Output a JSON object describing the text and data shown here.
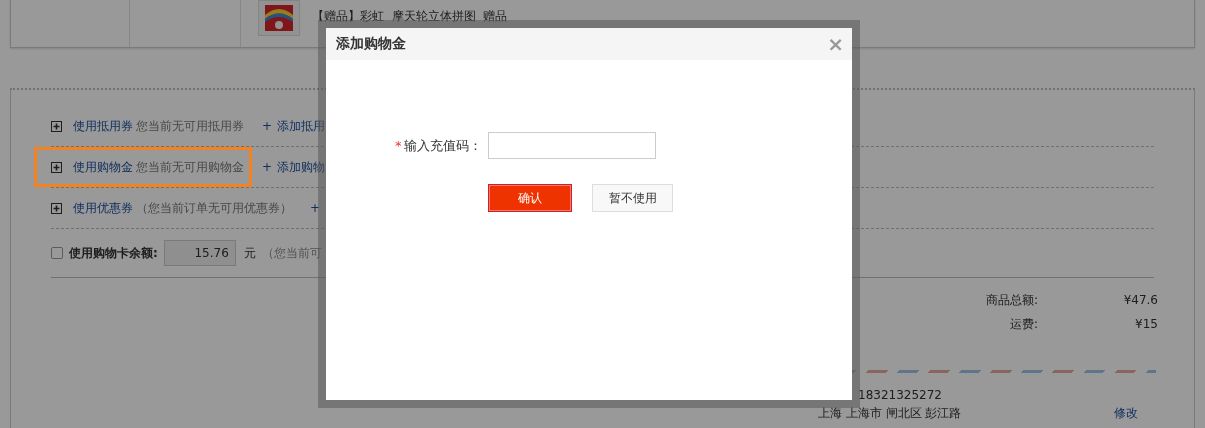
{
  "product": {
    "name": "【赠品】彩虹  摩天轮立体拼图  赠品"
  },
  "options": [
    {
      "kind": "expand",
      "label": "使用抵用券",
      "note": "您当前无可用抵用券",
      "add_icon": "+",
      "add_link": "添加抵用",
      "highlighted": false
    },
    {
      "kind": "expand",
      "label": "使用购物金",
      "note": "您当前无可用购物金",
      "add_icon": "+",
      "add_link": "添加购物",
      "highlighted": true
    },
    {
      "kind": "expand",
      "label": "使用优惠券",
      "note": "（您当前订单无可用优惠券）",
      "add_icon": "+",
      "highlighted": false
    },
    {
      "kind": "check",
      "label": "使用购物卡余额:",
      "checked": false,
      "value": "15.76",
      "unit": "元",
      "note": "（您当前可",
      "highlighted": false
    }
  ],
  "summary": [
    {
      "label": "商品总额:",
      "value": "¥47.6"
    },
    {
      "label": "运费:",
      "value": "¥15"
    }
  ],
  "address": {
    "phone": "18321325272",
    "line": "上海  上海市  闸北区  彭江路",
    "edit_link": "修改"
  },
  "dialog": {
    "title": "添加购物金",
    "close": "×",
    "field": {
      "required_mark": "*",
      "label": "输入充值码："
    },
    "buttons": [
      {
        "label": "确认",
        "kind": "primary"
      },
      {
        "label": "暂不使用",
        "kind": "secondary"
      }
    ]
  }
}
